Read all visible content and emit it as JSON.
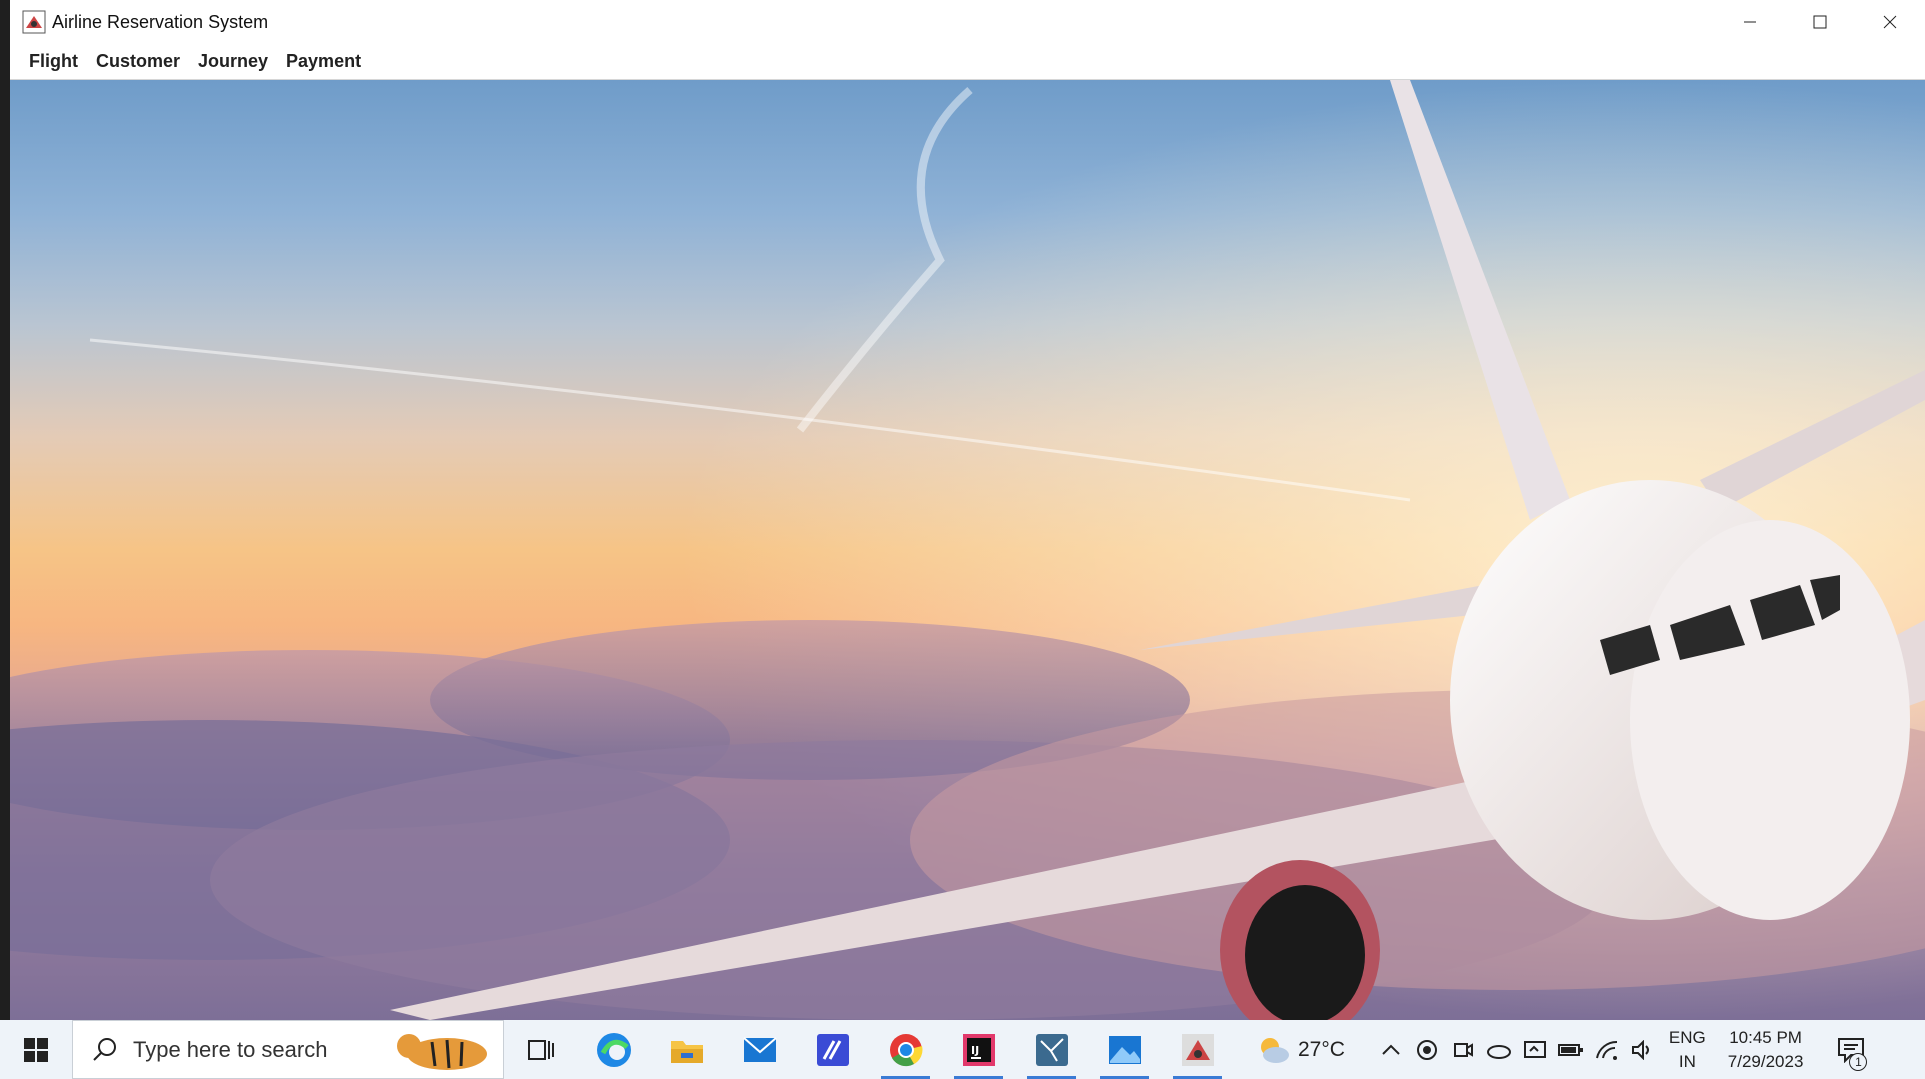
{
  "window": {
    "title": "Airline Reservation System"
  },
  "menu": {
    "items": [
      "Flight",
      "Customer",
      "Journey",
      "Payment"
    ]
  },
  "taskbar": {
    "search_placeholder": "Type here to search",
    "pinned_icons": [
      "task-view-icon",
      "edge-icon",
      "file-explorer-icon",
      "mail-icon",
      "app-icon",
      "chrome-icon",
      "intellij-icon",
      "app-icon",
      "photos-icon",
      "java-app-icon"
    ],
    "weather": {
      "temperature": "27°C"
    },
    "language": {
      "line1": "ENG",
      "line2": "IN"
    },
    "clock": {
      "time": "10:45 PM",
      "date": "7/29/2023"
    },
    "notification_count": "1"
  },
  "colors": {
    "taskbar_bg": "#eef3f9",
    "active_indicator": "#3a7bd5"
  }
}
